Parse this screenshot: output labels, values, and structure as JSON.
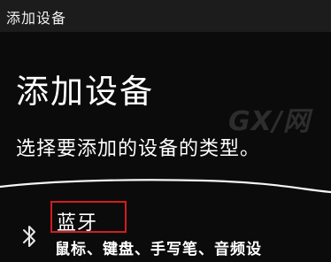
{
  "window": {
    "title": "添加设备"
  },
  "dialog": {
    "heading": "添加设备",
    "subheading": "选择要添加的设备的类型。"
  },
  "watermark": "GX/网",
  "option": {
    "icon": "bluetooth-icon",
    "name": "蓝牙",
    "description": "鼠标、键盘、手写笔、音频设"
  },
  "colors": {
    "background": "#0b0b0b",
    "titlebar": "#1c1c1c",
    "highlight_box": "#d21d1d"
  }
}
